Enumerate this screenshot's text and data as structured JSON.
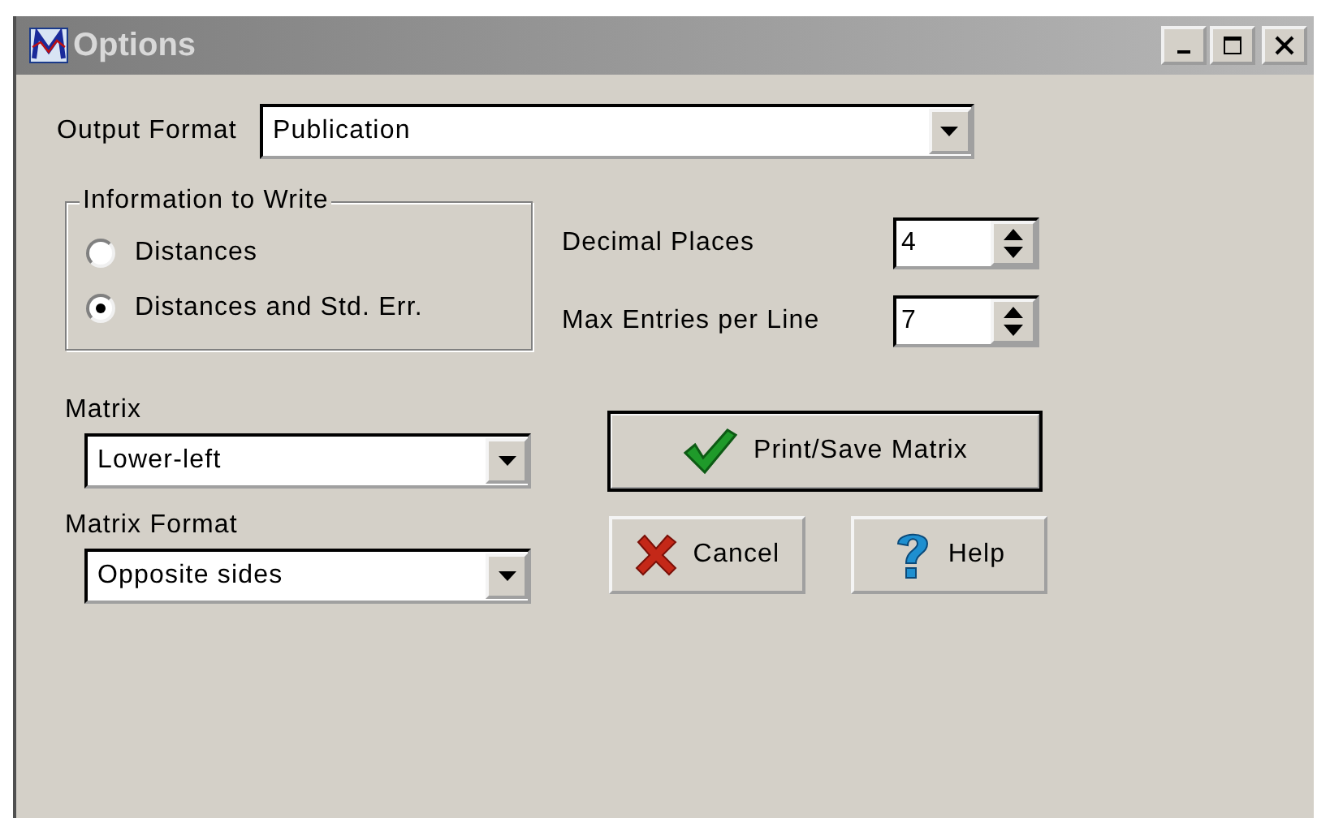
{
  "window": {
    "title": "Options"
  },
  "output_format": {
    "label": "Output Format",
    "value": "Publication"
  },
  "information_to_write": {
    "legend": "Information to Write",
    "options": [
      {
        "label": "Distances",
        "selected": false
      },
      {
        "label": "Distances and Std. Err.",
        "selected": true
      }
    ]
  },
  "spinners": [
    {
      "label": "Decimal Places",
      "value": "4"
    },
    {
      "label": "Max Entries per Line",
      "value": "7"
    }
  ],
  "combos": [
    {
      "label": "Matrix",
      "value": "Lower-left"
    },
    {
      "label": "Matrix Format",
      "value": "Opposite sides"
    }
  ],
  "buttons": [
    {
      "label": "Print/Save Matrix",
      "kind": "confirm",
      "default": true
    },
    {
      "label": "Cancel",
      "kind": "cancel",
      "default": false
    },
    {
      "label": "Help",
      "kind": "help",
      "default": false
    }
  ]
}
